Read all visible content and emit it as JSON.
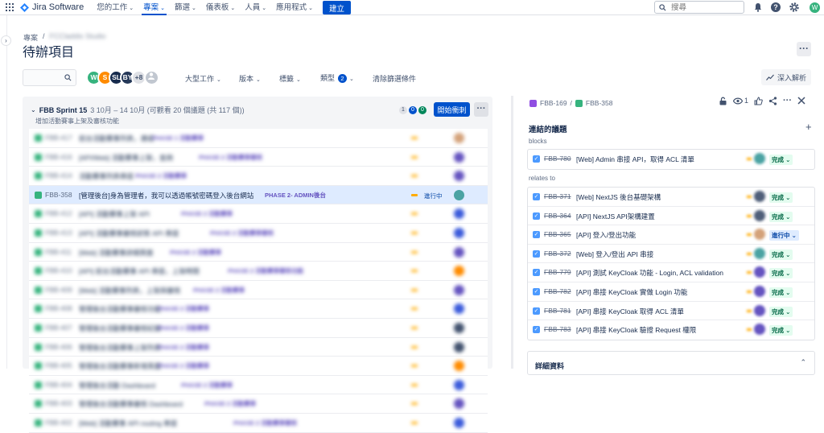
{
  "nav": {
    "product": "Jira Software",
    "items": [
      {
        "label": "您的工作",
        "active": false
      },
      {
        "label": "專案",
        "active": true
      },
      {
        "label": "篩選",
        "active": false
      },
      {
        "label": "儀表板",
        "active": false
      },
      {
        "label": "人員",
        "active": false
      },
      {
        "label": "應用程式",
        "active": false
      }
    ],
    "create_label": "建立",
    "search_placeholder": "搜尋",
    "user_initial": "W"
  },
  "header": {
    "breadcrumb_root": "專案",
    "breadcrumb_project": "FCCladdis Studio",
    "title": "待辦項目"
  },
  "filters": {
    "avatars": [
      {
        "initial": "W",
        "color": "#36b37e"
      },
      {
        "initial": "S",
        "color": "#ff8b00"
      },
      {
        "initial": "SL",
        "color": "#172b4d"
      },
      {
        "initial": "BY",
        "color": "#253858"
      }
    ],
    "more_count": "+8",
    "epic_label": "大型工作",
    "version_label": "版本",
    "label_label": "標籤",
    "type_label": "類型",
    "type_count": "2",
    "clear_label": "清除篩選條件",
    "insights_label": "深入解析"
  },
  "sprint": {
    "name": "FBB Sprint 15",
    "dates": "3 10月 – 14 10月 (可觀看 20 個議題 (共 117 個))",
    "goal": "增加活動賽事上架及審核功能",
    "count_todo": "1",
    "count_progress": "0",
    "count_done": "0",
    "start_label": "開始衝刺",
    "rows": [
      {
        "key": "FBB-417",
        "title": "前台活動賽事列表，連結",
        "epic": "PHASE 1 活動賽事",
        "blur": true,
        "avatar": "#d4a27a"
      },
      {
        "key": "FBB-416",
        "title": "[API/Web] 活動賽事上架，查詢",
        "epic": "PHASE 2 活動賽事審核",
        "blur": true,
        "avatar": "#6554c0"
      },
      {
        "key": "FBB-414",
        "title": "活動賽事列表串接",
        "epic": "PHASE 2 活動賽事",
        "blur": true,
        "avatar": "#6554c0"
      },
      {
        "key": "FBB-358",
        "title": "[管理後台]身為管理者，我可以透過帳號密碼登入後台網站",
        "epic": "PHASE 2- ADMIN後台",
        "blur": false,
        "status": "進行中",
        "avatar": "#4ba3a3"
      },
      {
        "key": "FBB-412",
        "title": "[API] 活動賽事上架 API",
        "epic": "PHASE 2 活動賽事",
        "blur": true,
        "avatar": "#3b5bdb"
      },
      {
        "key": "FBB-413",
        "title": "[API] 活動賽事審核狀態 API 串接",
        "epic": "PHASE 2 活動賽事審核",
        "blur": true,
        "avatar": "#3b5bdb"
      },
      {
        "key": "FBB-411",
        "title": "[Web] 活動賽事詳細頁面",
        "epic": "PHASE 2 活動賽事",
        "blur": true,
        "avatar": "#6554c0"
      },
      {
        "key": "FBB-410",
        "title": "[API] 前台活動賽事 API 串接，上架時間",
        "epic": "PHASE 2 活動賽事審核功能",
        "blur": true,
        "avatar": "#ff8b00"
      },
      {
        "key": "FBB-409",
        "title": "[Web] 活動賽事列表，上架與審核",
        "epic": "PHASE 2 活動賽事",
        "blur": true,
        "avatar": "#6554c0"
      },
      {
        "key": "FBB-408",
        "title": "管理後台活動賽事審核功能",
        "epic": "PHASE 2 活動賽事",
        "blur": true,
        "avatar": "#3b5bdb"
      },
      {
        "key": "FBB-407",
        "title": "管理後台活動賽事審核紀錄",
        "epic": "PHASE 2 活動賽事",
        "blur": true,
        "avatar": "#42526e"
      },
      {
        "key": "FBB-406",
        "title": "管理後台活動賽事上架列表",
        "epic": "PHASE 2 活動賽事",
        "blur": true,
        "avatar": "#42526e"
      },
      {
        "key": "FBB-405",
        "title": "管理後台活動賽事新增頁面",
        "epic": "PHASE 2 活動賽事",
        "blur": true,
        "avatar": "#ff8b00"
      },
      {
        "key": "FBB-404",
        "title": "管理後台活動 Dashboard",
        "epic": "PHASE 2 活動賽事",
        "blur": true,
        "avatar": "#3b5bdb"
      },
      {
        "key": "FBB-403",
        "title": "管理後台活動賽事審核 Dashboard",
        "epic": "PHASE 2 活動賽事",
        "blur": true,
        "avatar": "#6554c0"
      },
      {
        "key": "FBB-402",
        "title": "[Web] 活動賽事 API routing 串接",
        "epic": "PHASE 2 活動賽事審核",
        "blur": true,
        "avatar": "#3b5bdb"
      }
    ]
  },
  "detail": {
    "parent_key": "FBB-169",
    "issue_key": "FBB-358",
    "watch_count": "1",
    "linked_title": "連結的議題",
    "blocks_label": "blocks",
    "relates_label": "relates to",
    "blocks": [
      {
        "key": "FBB-780",
        "title": "[Web] Admin 串接 API，取得 ACL 清單",
        "status": "完成",
        "avatar": "#4ba3a3"
      }
    ],
    "relates": [
      {
        "key": "FBB-371",
        "title": "[Web] NextJS 後台基礎架構",
        "status": "完成",
        "avatar": "#505f79"
      },
      {
        "key": "FBB-364",
        "title": "[API] NextJS API架構建置",
        "status": "完成",
        "avatar": "#505f79"
      },
      {
        "key": "FBB-365",
        "title": "[API] 登入/登出功能",
        "status": "進行中",
        "avatar": "#d4a27a"
      },
      {
        "key": "FBB-372",
        "title": "[Web] 登入/登出 API 串接",
        "status": "完成",
        "avatar": "#4ba3a3"
      },
      {
        "key": "FBB-779",
        "title": "[API] 測試 KeyCloak 功能 - Login, ACL validation",
        "status": "完成",
        "avatar": "#6554c0"
      },
      {
        "key": "FBB-782",
        "title": "[API] 串接 KeyCloak 實做 Login 功能",
        "status": "完成",
        "avatar": "#6554c0"
      },
      {
        "key": "FBB-781",
        "title": "[API] 串接 KeyCloak 取得 ACL 清單",
        "status": "完成",
        "avatar": "#6554c0"
      },
      {
        "key": "FBB-783",
        "title": "[API] 串接 KeyCloak 驗證 Request 權限",
        "status": "完成",
        "avatar": "#6554c0"
      }
    ],
    "details_label": "詳細資料"
  }
}
